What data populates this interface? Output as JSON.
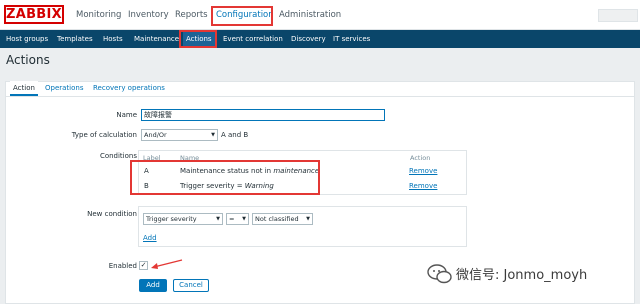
{
  "logo": "ZABBIX",
  "top_menu": {
    "items": [
      {
        "label": "Monitoring",
        "active": false
      },
      {
        "label": "Inventory",
        "active": false
      },
      {
        "label": "Reports",
        "active": false
      },
      {
        "label": "Configuration",
        "active": true
      },
      {
        "label": "Administration",
        "active": false
      }
    ]
  },
  "sub_menu": {
    "items": [
      {
        "label": "Host groups",
        "active": false
      },
      {
        "label": "Templates",
        "active": false
      },
      {
        "label": "Hosts",
        "active": false
      },
      {
        "label": "Maintenance",
        "active": false
      },
      {
        "label": "Actions",
        "active": true
      },
      {
        "label": "Event correlation",
        "active": false
      },
      {
        "label": "Discovery",
        "active": false
      },
      {
        "label": "IT services",
        "active": false
      }
    ]
  },
  "page_title": "Actions",
  "tabs": [
    {
      "label": "Action",
      "active": true
    },
    {
      "label": "Operations",
      "active": false
    },
    {
      "label": "Recovery operations",
      "active": false
    }
  ],
  "form": {
    "name_label": "Name",
    "name_value": "故障报警",
    "type_of_calculation_label": "Type of calculation",
    "type_of_calculation_value": "And/Or",
    "type_of_calculation_formula": "A and B",
    "conditions_label": "Conditions",
    "conditions_headers": {
      "label": "Label",
      "name": "Name",
      "action": "Action"
    },
    "conditions": [
      {
        "label": "A",
        "name_prefix": "Maintenance status not in ",
        "name_emphasis": "maintenance",
        "action": "Remove"
      },
      {
        "label": "B",
        "name_prefix": "Trigger severity = ",
        "name_emphasis": "Warning",
        "action": "Remove"
      }
    ],
    "new_condition_label": "New condition",
    "new_condition_type": "Trigger severity",
    "new_condition_operator": "=",
    "new_condition_value": "Not classified",
    "add_link": "Add",
    "enabled_label": "Enabled",
    "enabled_checked": true,
    "add_button": "Add",
    "cancel_button": "Cancel"
  },
  "watermark": "微信号: Jonmo_moyh",
  "colors": {
    "accent": "#0275b8",
    "nav_dark": "#0a466a",
    "logo_red": "#d40000",
    "highlight_red": "#e33734"
  }
}
